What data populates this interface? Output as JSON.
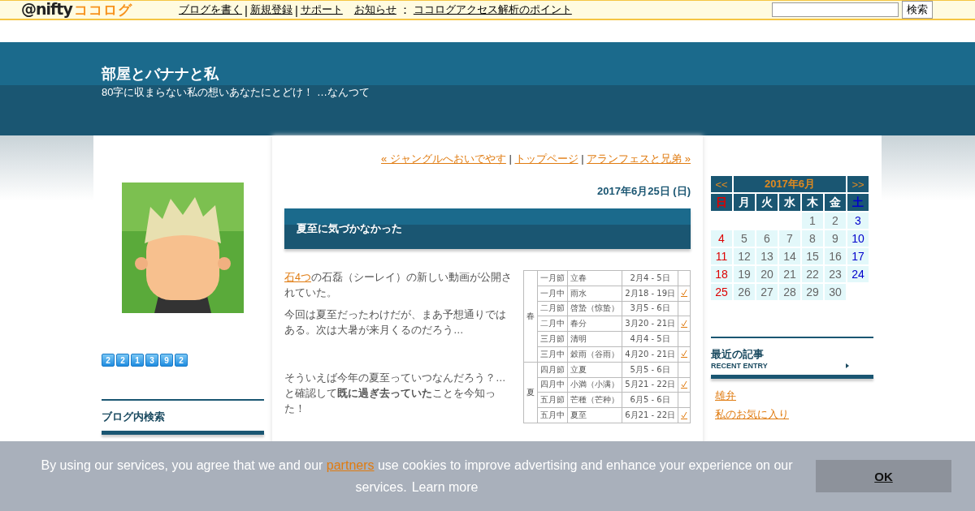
{
  "topbar": {
    "logo": {
      "brand": "@nifty",
      "service": "ココログ"
    },
    "links": [
      {
        "kind": "link",
        "text": "ブログを書く"
      },
      {
        "kind": "sep",
        "text": "|"
      },
      {
        "kind": "link",
        "text": "新規登録"
      },
      {
        "kind": "sep",
        "text": "|"
      },
      {
        "kind": "link",
        "text": "サポート"
      }
    ],
    "notice": {
      "label": "お知らせ",
      "colon": "：",
      "link": "ココログアクセス解析のポイント"
    },
    "search_button": "検索"
  },
  "header": {
    "title": "部屋とバナナと私",
    "subtitle": "80字に収まらない私の想いあなたにとどけ！ …なんつて"
  },
  "left": {
    "avatar": {
      "kind": "picture"
    },
    "counter": [
      "2",
      "2",
      "1",
      "3",
      "9",
      "2"
    ],
    "search_heading": "ブログ内検索"
  },
  "post": {
    "nav": [
      {
        "kind": "link",
        "text": "« ジャングルへおいでやす"
      },
      {
        "kind": "sep",
        "text": "|"
      },
      {
        "kind": "link",
        "text": "トップページ"
      },
      {
        "kind": "sep",
        "text": "|"
      },
      {
        "kind": "link",
        "text": "アランフェスと兄弟 »"
      }
    ],
    "date": "2017年6月25日 (日)",
    "title": "夏至に気づかなかった",
    "intro": {
      "link": "石4つ",
      "text": "の石磊（シーレイ）の新しい動画が公開されていた。"
    },
    "paragraphs": [
      "今回は夏至だったわけだが、まあ予想通りではある。次は大暑が来月くるのだろう…",
      "そういえば今年の夏至っていつなんだろう？…と確認して**既に過ぎ去っていた**ことを今知った！"
    ],
    "table": [
      {
        "season": "春",
        "rows": [
          {
            "term": "一月節",
            "name": "立春",
            "date": "2月4 - 5日",
            "checked": false
          },
          {
            "term": "一月中",
            "name": "雨水",
            "date": "2月18 - 19日",
            "checked": true
          },
          {
            "term": "二月節",
            "name": "啓蟄（惊蛰）",
            "date": "3月5 - 6日",
            "checked": false
          },
          {
            "term": "二月中",
            "name": "春分",
            "date": "3月20 - 21日",
            "checked": true
          },
          {
            "term": "三月節",
            "name": "清明",
            "date": "4月4 - 5日",
            "checked": false
          },
          {
            "term": "三月中",
            "name": "穀雨（谷雨）",
            "date": "4月20 - 21日",
            "checked": true
          }
        ]
      },
      {
        "season": "夏",
        "rows": [
          {
            "term": "四月節",
            "name": "立夏",
            "date": "5月5 - 6日",
            "checked": false
          },
          {
            "term": "四月中",
            "name": "小満（小满）",
            "date": "5月21 - 22日",
            "checked": true
          },
          {
            "term": "五月節",
            "name": "芒種（芒种）",
            "date": "6月5 - 6日",
            "checked": false
          },
          {
            "term": "五月中",
            "name": "夏至",
            "date": "6月21 - 22日",
            "checked": true
          }
        ]
      }
    ]
  },
  "right": {
    "calendar": {
      "prev": "<<",
      "title": "2017年6月",
      "next": ">>",
      "weekdays": [
        "日",
        "月",
        "火",
        "水",
        "木",
        "金",
        "土"
      ],
      "weeks": [
        [
          "1",
          "2",
          "3"
        ],
        [
          "4",
          "5",
          "6",
          "7",
          "8",
          "9",
          "10"
        ],
        [
          "11",
          "12",
          "13",
          "14",
          "15",
          "16",
          "17"
        ],
        [
          "18",
          "19",
          "20",
          "21",
          "22",
          "23",
          "24"
        ],
        [
          "25",
          "26",
          "27",
          "28",
          "29",
          "30"
        ]
      ]
    },
    "recent": {
      "heading": "最近の記事",
      "subheading": "RECENT ENTRY",
      "items": [
        "雄弁",
        "私のお気に入り"
      ]
    }
  },
  "cookie_banner": {
    "text_before": "By using our services, you agree that we and our",
    "partners_link": "partners",
    "text_after": "use cookies to improve advertising and enhance your experience on our services.",
    "learn_more": "Learn more",
    "ok_button": "OK"
  }
}
